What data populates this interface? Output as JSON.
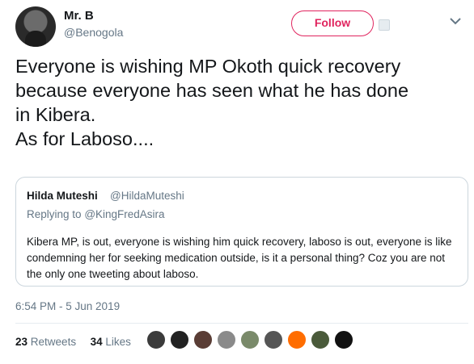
{
  "author": {
    "display_name": "Mr. B",
    "handle": "@Benogola",
    "avatar_icon": "avatar-photo"
  },
  "follow": {
    "label": "Follow",
    "color": "#e0245e"
  },
  "tweet": {
    "text": "Everyone is wishing MP Okoth quick recovery\nbecause everyone has seen what he has done\nin Kibera.\nAs for Laboso...."
  },
  "quoted": {
    "name": "Hilda Muteshi",
    "handle": "@HildaMuteshi",
    "replying_prefix": "Replying to",
    "replying_to": "@KingFredAsira",
    "text": "Kibera MP, is out, everyone is wishing him quick recovery, laboso is out, everyone is like condemning her for seeking medication outside, is it a personal thing? Coz you are not the only one tweeting about laboso."
  },
  "timestamp": "6:54 PM - 5 Jun 2019",
  "stats": {
    "retweets_count": "23",
    "retweets_label": "Retweets",
    "likes_count": "34",
    "likes_label": "Likes"
  },
  "likers": [
    {
      "name": "liker-avatar-1",
      "color": "#3b3b3b"
    },
    {
      "name": "liker-avatar-2",
      "color": "#222222"
    },
    {
      "name": "liker-avatar-3",
      "color": "#5a3d35"
    },
    {
      "name": "liker-avatar-4",
      "color": "#8a8a8a"
    },
    {
      "name": "liker-avatar-5",
      "color": "#7a8a6a"
    },
    {
      "name": "liker-avatar-6",
      "color": "#555555"
    },
    {
      "name": "liker-avatar-7",
      "color": "#ff6d00"
    },
    {
      "name": "liker-avatar-8",
      "color": "#4a5a3a"
    },
    {
      "name": "liker-avatar-9",
      "color": "#111111"
    }
  ]
}
